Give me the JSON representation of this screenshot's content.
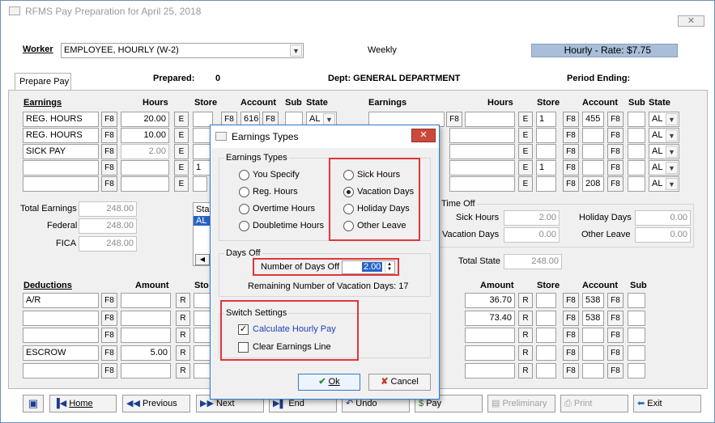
{
  "window": {
    "title": "RFMS Pay Preparation for April 25, 2018",
    "close": "✕"
  },
  "worker": {
    "label": "Worker",
    "value": "EMPLOYEE, HOURLY (W-2)",
    "frequency": "Weekly",
    "rate": "Hourly - Rate: $7.75"
  },
  "tab": "Prepare Pay",
  "header": {
    "prepared_label": "Prepared:",
    "prepared_value": "0",
    "dept": "Dept: GENERAL DEPARTMENT",
    "period": "Period Ending:"
  },
  "earn_cols": {
    "earnings": "Earnings",
    "hours": "Hours",
    "store": "Store",
    "account": "Account",
    "sub": "Sub",
    "state": "State"
  },
  "left_rows": [
    {
      "earning": "REG. HOURS",
      "f8": "F8",
      "hours": "20.00",
      "e": "E",
      "store": "",
      "f8b": "F8",
      "account": "616",
      "f8c": "F8",
      "state": "AL"
    },
    {
      "earning": "REG. HOURS",
      "f8": "F8",
      "hours": "10.00",
      "e": "E",
      "store": "",
      "f8b": "F8",
      "account": "",
      "f8c": "F8",
      "state": ""
    },
    {
      "earning": "SICK PAY",
      "f8": "F8",
      "hours": "2.00",
      "e": "E",
      "store": "",
      "f8b": "F8",
      "account": "",
      "f8c": "F8",
      "state": ""
    },
    {
      "earning": "",
      "f8": "F8",
      "hours": "",
      "e": "E",
      "store": "1",
      "f8b": "F8",
      "account": "",
      "f8c": "F8",
      "state": ""
    },
    {
      "earning": "",
      "f8": "F8",
      "hours": "",
      "e": "E",
      "store": "",
      "f8b": "F8",
      "account": "",
      "f8c": "F8",
      "state": ""
    }
  ],
  "right_rows": [
    {
      "e": "E",
      "store": "1",
      "f8b": "F8",
      "account": "455",
      "f8c": "F8",
      "state": "AL"
    },
    {
      "e": "E",
      "store": "",
      "f8b": "F8",
      "account": "",
      "f8c": "F8",
      "state": "AL"
    },
    {
      "e": "E",
      "store": "",
      "f8b": "F8",
      "account": "",
      "f8c": "F8",
      "state": "AL"
    },
    {
      "e": "E",
      "store": "1",
      "f8b": "F8",
      "account": "",
      "f8c": "F8",
      "state": "AL"
    },
    {
      "e": "E",
      "store": "",
      "f8b": "F8",
      "account": "208",
      "f8c": "F8",
      "state": "AL"
    }
  ],
  "totals": {
    "total_label": "Total Earnings",
    "total": "248.00",
    "federal_label": "Federal",
    "federal": "248.00",
    "fica_label": "FICA",
    "fica": "248.00",
    "state_list_header": "Sta",
    "state_list_item": "AL"
  },
  "time_off": {
    "title": "Time Off",
    "sick_label": "Sick Hours",
    "sick": "2.00",
    "holiday_label": "Holiday Days",
    "holiday": "0.00",
    "vacation_label": "Vacation Days",
    "vacation": "0.00",
    "other_label": "Other Leave",
    "other": "0.00",
    "total_state_label": "Total State",
    "total_state": "248.00"
  },
  "ded_cols": {
    "deductions": "Deductions",
    "amount": "Amount",
    "store": "Sto",
    "amount2": "Amount",
    "store2": "Store",
    "account": "Account",
    "sub": "Sub"
  },
  "ded_left": [
    {
      "name": "A/R",
      "f8": "F8",
      "amount": "",
      "r": "R"
    },
    {
      "name": "",
      "f8": "F8",
      "amount": "",
      "r": "R"
    },
    {
      "name": "",
      "f8": "F8",
      "amount": "",
      "r": "R"
    },
    {
      "name": "ESCROW",
      "f8": "F8",
      "amount": "5.00",
      "r": "R"
    },
    {
      "name": "",
      "f8": "F8",
      "amount": "",
      "r": "R"
    }
  ],
  "ded_right": [
    {
      "amount": "36.70",
      "r": "R",
      "store": "",
      "f8": "F8",
      "account": "538",
      "f8b": "F8"
    },
    {
      "amount": "73.40",
      "r": "R",
      "store": "",
      "f8": "F8",
      "account": "538",
      "f8b": "F8"
    },
    {
      "amount": "",
      "r": "R",
      "store": "",
      "f8": "F8",
      "account": "",
      "f8b": "F8"
    },
    {
      "amount": "",
      "r": "R",
      "store": "",
      "f8": "F8",
      "account": "",
      "f8b": "F8"
    },
    {
      "amount": "",
      "r": "R",
      "store": "",
      "f8": "F8",
      "account": "",
      "f8b": "F8"
    }
  ],
  "nav": {
    "home": "Home",
    "previous": "Previous",
    "next": "Next",
    "end": "End",
    "undo": "Undo",
    "pay": "Pay",
    "preliminary": "Preliminary",
    "print": "Print",
    "exit": "Exit"
  },
  "dialog": {
    "title": "Earnings Types",
    "close": "✕",
    "group_types": "Earnings Types",
    "you_specify": "You Specify",
    "reg_hours": "Reg. Hours",
    "overtime_hours": "Overtime Hours",
    "doubletime_hours": "Doubletime Hours",
    "sick_hours": "Sick Hours",
    "vacation_days": "Vacation Days",
    "holiday_days": "Holiday Days",
    "other_leave": "Other Leave",
    "group_days": "Days Off",
    "num_days_label": "Number of Days Off",
    "num_days_value": "2.00",
    "remaining": "Remaining Number of Vacation Days: 17",
    "group_switch": "Switch Settings",
    "calc_hourly": "Calculate Hourly Pay",
    "clear_line": "Clear Earnings Line",
    "ok": "Ok",
    "cancel": "Cancel"
  }
}
